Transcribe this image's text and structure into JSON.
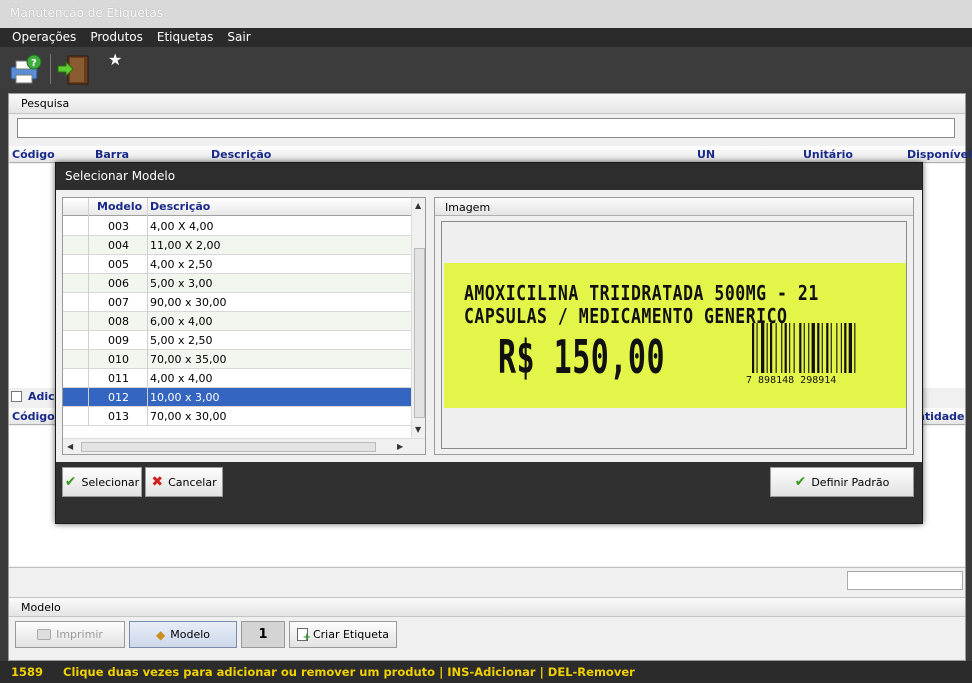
{
  "window": {
    "title": "Manutenção de Etiquetas"
  },
  "menu": [
    "Operações",
    "Produtos",
    "Etiquetas",
    "Sair"
  ],
  "search": {
    "header": "Pesquisa",
    "value": ""
  },
  "products_grid": {
    "columns": [
      "Código",
      "Barra",
      "Descrição",
      "UN",
      "Unitário",
      "Disponível"
    ]
  },
  "lower": {
    "add_checkbox_label": "Adici",
    "col_codigo": "Código",
    "col_quantidade": "ntidade"
  },
  "model_section": {
    "header": "Modelo"
  },
  "buttons": {
    "imprimir": "Imprimir",
    "modelo": "Modelo",
    "copies": "1",
    "criar_etiqueta": "Criar Etiqueta"
  },
  "status": {
    "code": "1589",
    "message": "Clique duas vezes para adicionar ou remover um produto | INS-Adicionar | DEL-Remover"
  },
  "dialog": {
    "title": "Selecionar Modelo",
    "grid_columns": [
      "Modelo",
      "Descrição"
    ],
    "rows": [
      {
        "modelo": "003",
        "descricao": "4,00 X 4,00"
      },
      {
        "modelo": "004",
        "descricao": "11,00 X 2,00"
      },
      {
        "modelo": "005",
        "descricao": "4,00 x 2,50"
      },
      {
        "modelo": "006",
        "descricao": "5,00 x 3,00"
      },
      {
        "modelo": "007",
        "descricao": "90,00 x 30,00"
      },
      {
        "modelo": "008",
        "descricao": "6,00 x 4,00"
      },
      {
        "modelo": "009",
        "descricao": "5,00 x 2,50"
      },
      {
        "modelo": "010",
        "descricao": "70,00 x 35,00"
      },
      {
        "modelo": "011",
        "descricao": "4,00 x 4,00"
      },
      {
        "modelo": "012",
        "descricao": "10,00 x 3,00"
      },
      {
        "modelo": "013",
        "descricao": "70,00 x 30,00"
      }
    ],
    "selected_modelo": "012",
    "image_header": "Imagem",
    "label_preview": {
      "line1": "AMOXICILINA TRIIDRATADA 500MG - 21",
      "line2": "CAPSULAS / MEDICAMENTO GENERICO",
      "price": "R$ 150,00",
      "barcode_digits": "7 898148 298914",
      "background": "#e4f54a"
    },
    "buttons": {
      "selecionar": "Selecionar",
      "cancelar": "Cancelar",
      "definir_padrao": "Definir Padrão"
    }
  },
  "colors": {
    "header_text": "#1a2a8a",
    "selection": "#3465c0",
    "status_text": "#f0d000"
  }
}
